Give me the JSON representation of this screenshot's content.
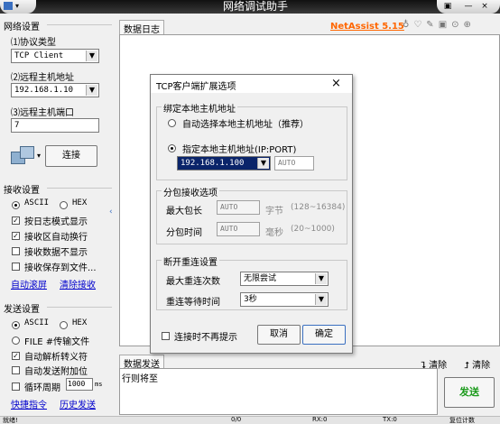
{
  "app": {
    "title": "网络调试助手",
    "brand": "NetAssist 5.15",
    "window_controls": [
      "—",
      "×"
    ]
  },
  "left_panel": {
    "network": {
      "title": "网络设置",
      "protocol_label": "⑴协议类型",
      "protocol_value": "TCP Client",
      "remote_ip_label": "⑵远程主机地址",
      "remote_ip_value": "192.168.1.10",
      "remote_port_label": "⑶远程主机端口",
      "remote_port_value": "7",
      "connect_button": "连接"
    },
    "receive": {
      "title": "接收设置",
      "ascii": "ASCII",
      "hex": "HEX",
      "options": [
        {
          "label": "按日志模式显示",
          "checked": true
        },
        {
          "label": "接收区自动换行",
          "checked": true
        },
        {
          "label": "接收数据不显示",
          "checked": false
        },
        {
          "label": "接收保存到文件...",
          "checked": false
        }
      ],
      "auto_scroll": "自动滚屏",
      "clear_receive": "清除接收"
    },
    "send": {
      "title": "发送设置",
      "ascii": "ASCII",
      "hex": "HEX",
      "file_option": "FILE #传输文件",
      "options": [
        {
          "label": "自动解析转义符",
          "checked": true
        },
        {
          "label": "自动发送附加位",
          "checked": false
        }
      ],
      "cycle_label": "循环周期",
      "cycle_value": "1000",
      "cycle_unit": "ms",
      "quick_cmd": "快捷指令",
      "history": "历史发送"
    }
  },
  "main": {
    "log_tab": "数据日志",
    "send_tab": "数据发送",
    "clear_1": "清除",
    "clear_2": "清除",
    "send_text": "行则将至",
    "send_button": "发送",
    "status_left": "就绪!",
    "status_rx": "0/0",
    "status_rx2": "RX:0",
    "status_tx": "TX:0",
    "status_reset": "复位计数"
  },
  "dialog": {
    "title": "TCP客户端扩展选项",
    "close": "×",
    "bind_group": "绑定本地主机地址",
    "auto_select": "自动选择本地主机地址（推荐）",
    "specify": "指定本地主机地址(IP:PORT)",
    "local_ip": "192.168.1.100",
    "local_port": "AUTO",
    "packet_group": "分包接收选项",
    "max_len_label": "最大包长",
    "max_len_value": "AUTO",
    "max_len_unit": "字节",
    "max_len_range": "(128~16384)",
    "time_label": "分包时间",
    "time_value": "AUTO",
    "time_unit": "毫秒",
    "time_range": "(20~1000)",
    "reconnect_group": "断开重连设置",
    "max_retry_label": "最大重连次数",
    "max_retry_value": "无限尝试",
    "retry_wait_label": "重连等待时间",
    "retry_wait_value": "3秒",
    "no_prompt": "连接时不再提示",
    "cancel": "取消",
    "ok": "确定"
  },
  "colors": {
    "brand": "#ff6600",
    "send_button": "#1a9a1a",
    "link": "#0000cc",
    "selection": "#0a246a"
  }
}
